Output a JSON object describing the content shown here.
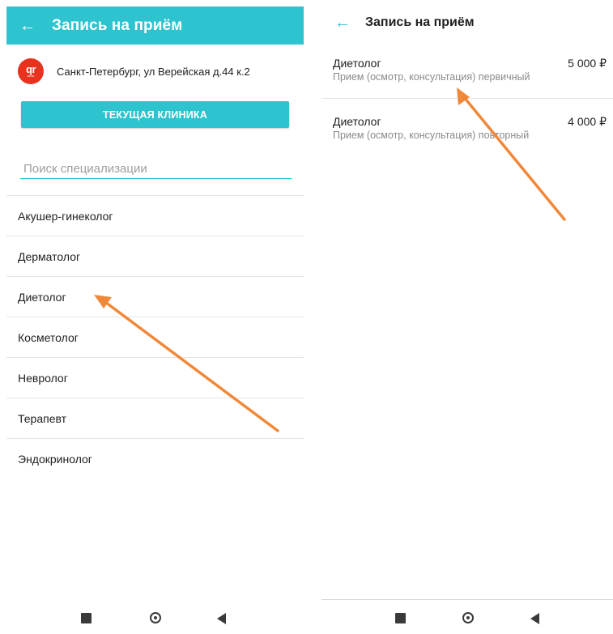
{
  "left_screen": {
    "header": {
      "back_icon": "arrow-left-icon",
      "title": "Запись на приём"
    },
    "clinic": {
      "logo_text": "qr",
      "logo_subtext": "clinic",
      "address": "Санкт-Петербург, ул Верейская д.44 к.2"
    },
    "current_clinic_button": "ТЕКУЩАЯ КЛИНИКА",
    "search": {
      "placeholder": "Поиск специализации",
      "value": ""
    },
    "specializations": [
      "Акушер-гинеколог",
      "Дерматолог",
      "Диетолог",
      "Косметолог",
      "Невролог",
      "Терапевт",
      "Эндокринолог"
    ]
  },
  "right_screen": {
    "header": {
      "back_icon": "arrow-left-icon",
      "title": "Запись на приём"
    },
    "services": [
      {
        "name": "Диетолог",
        "description": "Прием (осмотр, консультация) первичный",
        "price": "5 000 ₽"
      },
      {
        "name": "Диетолог",
        "description": "Прием (осмотр, консультация) повторный",
        "price": "4 000 ₽"
      }
    ]
  },
  "navbar": {
    "icons": [
      "recent-apps-icon",
      "home-icon",
      "back-triangle-icon"
    ]
  },
  "colors": {
    "accent": "#2dc4cf",
    "annotation_arrow": "#f0883a",
    "logo_red": "#e8321e"
  }
}
